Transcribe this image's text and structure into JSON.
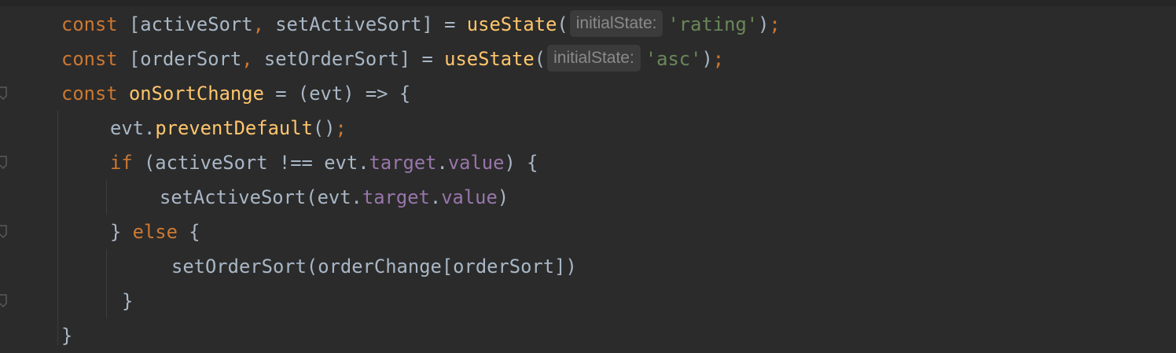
{
  "code_lines": [
    {
      "indent": 78,
      "tokens": [
        {
          "t": "const ",
          "c": "kw"
        },
        {
          "t": "[activeSort",
          "c": "plain"
        },
        {
          "t": ", ",
          "c": "kw"
        },
        {
          "t": "setActiveSort] = ",
          "c": "plain"
        },
        {
          "t": "useState",
          "c": "fn"
        },
        {
          "t": "(",
          "c": "plain"
        },
        {
          "t": "initialState:",
          "c": "hint"
        },
        {
          "t": "'rating'",
          "c": "str"
        },
        {
          "t": ")",
          "c": "plain"
        },
        {
          "t": ";",
          "c": "kw"
        }
      ]
    },
    {
      "indent": 78,
      "tokens": [
        {
          "t": "const ",
          "c": "kw"
        },
        {
          "t": "[orderSort",
          "c": "plain"
        },
        {
          "t": ", ",
          "c": "kw"
        },
        {
          "t": "setOrderSort] = ",
          "c": "plain"
        },
        {
          "t": "useState",
          "c": "fn"
        },
        {
          "t": "(",
          "c": "plain"
        },
        {
          "t": "initialState:",
          "c": "hint"
        },
        {
          "t": "'asc'",
          "c": "str"
        },
        {
          "t": ")",
          "c": "plain"
        },
        {
          "t": ";",
          "c": "kw"
        }
      ]
    },
    {
      "indent": 78,
      "tokens": [
        {
          "t": "const ",
          "c": "kw"
        },
        {
          "t": "onSortChange",
          "c": "fn"
        },
        {
          "t": " = (evt) => {",
          "c": "plain"
        }
      ]
    },
    {
      "indent": 140,
      "tokens": [
        {
          "t": "evt.",
          "c": "plain"
        },
        {
          "t": "preventDefault",
          "c": "fn"
        },
        {
          "t": "()",
          "c": "plain"
        },
        {
          "t": ";",
          "c": "kw"
        }
      ]
    },
    {
      "indent": 140,
      "tokens": [
        {
          "t": "if ",
          "c": "kw"
        },
        {
          "t": "(activeSort !== evt.",
          "c": "plain"
        },
        {
          "t": "target",
          "c": "prop"
        },
        {
          "t": ".",
          "c": "plain"
        },
        {
          "t": "value",
          "c": "prop"
        },
        {
          "t": ") {",
          "c": "plain"
        }
      ]
    },
    {
      "indent": 203,
      "tokens": [
        {
          "t": "setActiveSort(evt.",
          "c": "plain"
        },
        {
          "t": "target",
          "c": "prop"
        },
        {
          "t": ".",
          "c": "plain"
        },
        {
          "t": "value",
          "c": "prop"
        },
        {
          "t": ")",
          "c": "plain"
        }
      ]
    },
    {
      "indent": 140,
      "tokens": [
        {
          "t": "} ",
          "c": "plain"
        },
        {
          "t": "else ",
          "c": "kw"
        },
        {
          "t": "{",
          "c": "plain"
        }
      ]
    },
    {
      "indent": 218,
      "tokens": [
        {
          "t": "setOrderSort(orderChange[orderSort])",
          "c": "plain"
        }
      ]
    },
    {
      "indent": 155,
      "tokens": [
        {
          "t": "}",
          "c": "plain"
        }
      ]
    },
    {
      "indent": 78,
      "tokens": [
        {
          "t": "}",
          "c": "plain"
        }
      ]
    }
  ],
  "colors": {
    "background": "#2b2b2b",
    "keyword": "#cc7832",
    "function": "#ffc66d",
    "property": "#9876aa",
    "string": "#6a8759",
    "plain": "#a9b7c6",
    "hint_text": "#8a8a8a",
    "hint_background": "#3b3b3b"
  },
  "gutter_icons": [
    "fold-marker-icon"
  ]
}
